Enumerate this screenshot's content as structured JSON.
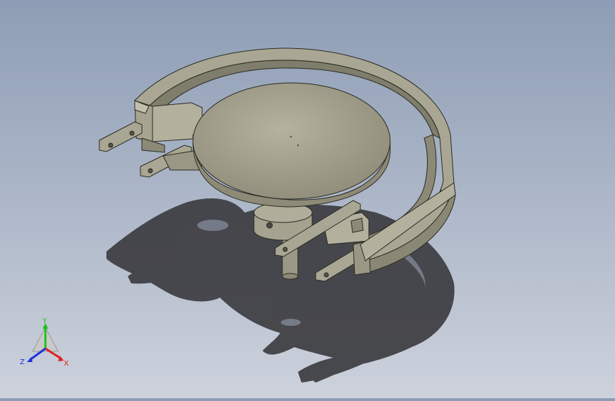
{
  "viewport": {
    "background_top": "#8e9db5",
    "background_bottom": "#cdd2dc",
    "model_color": "#a8a692",
    "model_dark": "#7d7b68",
    "model_edge": "#2a2a22",
    "shadow_color": "#3a3a3e"
  },
  "triad": {
    "x_label": "X",
    "y_label": "Y",
    "z_label": "Z",
    "x_color": "#e02020",
    "y_color": "#20c020",
    "z_color": "#2030e0"
  }
}
